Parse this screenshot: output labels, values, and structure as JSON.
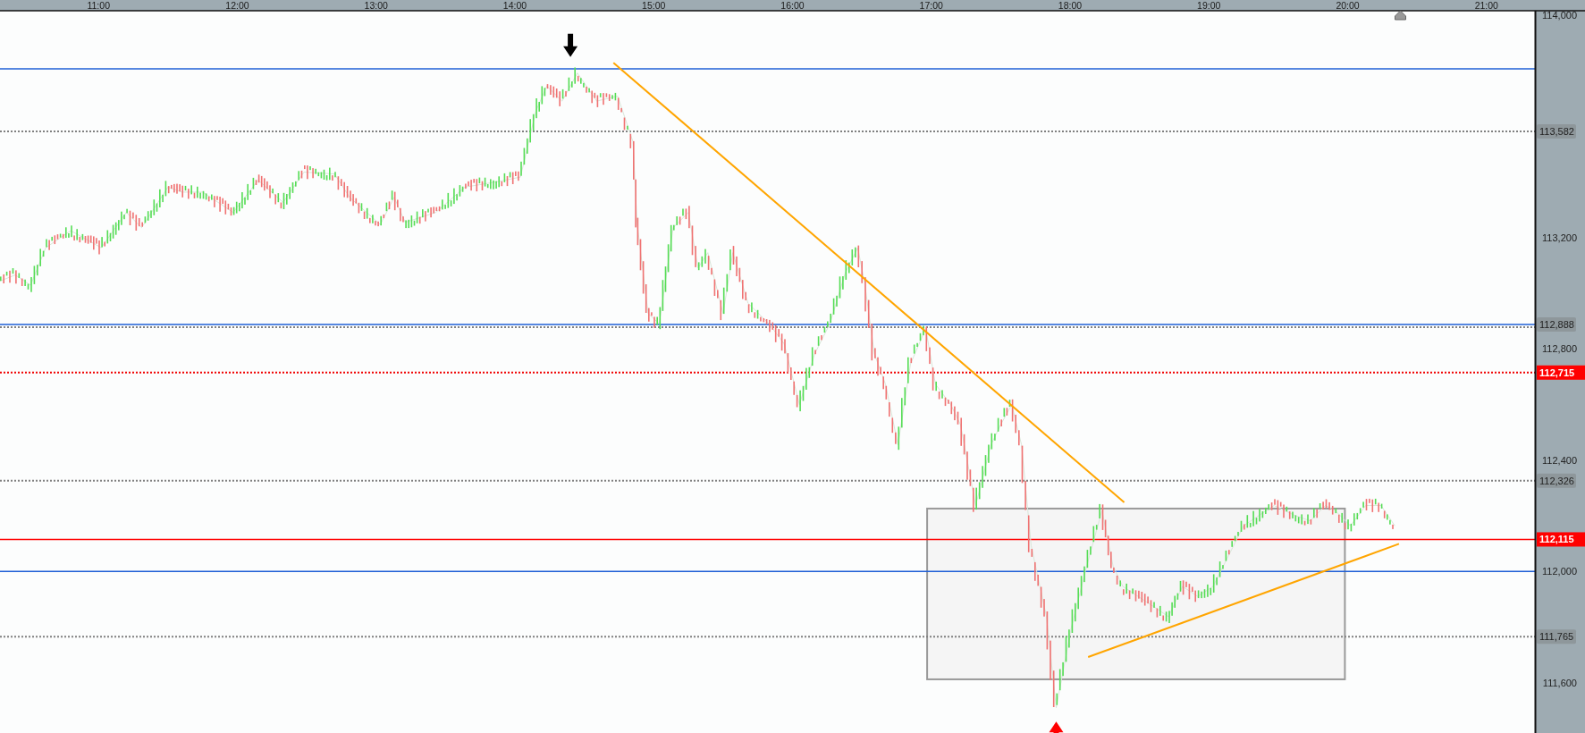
{
  "chart": {
    "chart_data": {
      "type": "line",
      "x": [
        10.29,
        10.4,
        10.51,
        10.62,
        10.8,
        11.02,
        11.2,
        11.31,
        11.5,
        11.6,
        11.75,
        11.97,
        12.15,
        12.33,
        12.48,
        12.7,
        12.81,
        13.03,
        13.13,
        13.21,
        13.43,
        13.64,
        13.86,
        14.04,
        14.15,
        14.23,
        14.34,
        14.45,
        14.59,
        14.74,
        14.85,
        14.88,
        14.96,
        15.04,
        15.14,
        15.25,
        15.32,
        15.39,
        15.5,
        15.57,
        15.68,
        15.83,
        15.94,
        16.05,
        16.16,
        16.27,
        16.38,
        16.47,
        16.52,
        16.59,
        16.67,
        16.76,
        16.85,
        16.96,
        17.03,
        17.14,
        17.21,
        17.32,
        17.43,
        17.5,
        17.58,
        17.65,
        17.72,
        17.83,
        17.9,
        18.01,
        18.12,
        18.23,
        18.31,
        18.38,
        18.49,
        18.6,
        18.71,
        18.81,
        18.92,
        19.03,
        19.14,
        19.25,
        19.36,
        19.47,
        19.62,
        19.73,
        19.84,
        19.91,
        20.02,
        20.13,
        20.24,
        20.34
      ],
      "series": [
        {
          "values": [
            113044,
            113066,
            113029,
            113164,
            113225,
            113164,
            113291,
            113236,
            113382,
            113364,
            113364,
            113291,
            113407,
            113327,
            113436,
            113429,
            113345,
            113247,
            113345,
            113255,
            113291,
            113382,
            113400,
            113418,
            113654,
            113745,
            113691,
            113792,
            113691,
            113709,
            113545,
            113255,
            112927,
            112891,
            113236,
            113291,
            113091,
            113146,
            112927,
            113146,
            112964,
            112891,
            112818,
            112600,
            112782,
            112891,
            113073,
            113164,
            113037,
            112782,
            112673,
            112455,
            112746,
            112873,
            112673,
            112600,
            112528,
            112237,
            112455,
            112528,
            112600,
            112455,
            112092,
            111837,
            111510,
            111801,
            112019,
            112219,
            112019,
            111946,
            111910,
            111874,
            111837,
            111946,
            111910,
            111946,
            112055,
            112164,
            112201,
            112237,
            112201,
            112182,
            112237,
            112219,
            112164,
            112237,
            112237,
            112164
          ]
        }
      ],
      "xlim": [
        10.29,
        21.71
      ],
      "ylim": [
        111419,
        114016
      ],
      "xticks": [
        {
          "value": 11,
          "label": "11:00"
        },
        {
          "value": 12,
          "label": "12:00"
        },
        {
          "value": 13,
          "label": "13:00"
        },
        {
          "value": 14,
          "label": "14:00"
        },
        {
          "value": 15,
          "label": "15:00"
        },
        {
          "value": 16,
          "label": "16:00"
        },
        {
          "value": 17,
          "label": "17:00"
        },
        {
          "value": 18,
          "label": "18:00"
        },
        {
          "value": 19,
          "label": "19:00"
        },
        {
          "value": 20,
          "label": "20:00"
        },
        {
          "value": 21,
          "label": "21:00"
        }
      ],
      "yticks": [
        {
          "value": 114000,
          "label": "114,000"
        },
        {
          "value": 113200,
          "label": "113,200"
        },
        {
          "value": 112800,
          "label": "112,800"
        },
        {
          "value": 112400,
          "label": "112,400"
        },
        {
          "value": 112000,
          "label": "112,000"
        },
        {
          "value": 111600,
          "label": "111,600"
        }
      ],
      "ref_lines": [
        {
          "axis": "y",
          "value": 113807,
          "color": "#1f5fd6"
        },
        {
          "axis": "y",
          "value": 113582,
          "color": "#808080",
          "label": "113,582"
        },
        {
          "axis": "y",
          "value": 112888,
          "color": "#1f5fd6"
        },
        {
          "axis": "y",
          "value": 112888,
          "color": "#808080",
          "label": "112,888"
        },
        {
          "axis": "y",
          "value": 112715,
          "color": "#f00000",
          "label": "112,715"
        },
        {
          "axis": "y",
          "value": 112326,
          "color": "#808080",
          "label": "112,326"
        },
        {
          "axis": "y",
          "value": 112115,
          "color": "#ff0000",
          "label": "112,115"
        },
        {
          "axis": "y",
          "value": 112000,
          "color": "#1f5fd6"
        },
        {
          "axis": "y",
          "value": 111765,
          "color": "#808080",
          "label": "111,765"
        }
      ]
    }
  }
}
